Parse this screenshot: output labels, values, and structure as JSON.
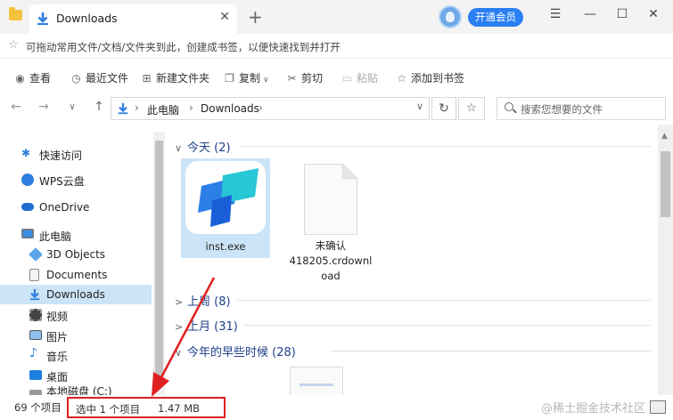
{
  "titlebar": {
    "tab_label": "Downloads",
    "tab_close": "✕",
    "new_tab": "+",
    "vip_button": "开通会员",
    "menu": "☰",
    "minimize": "—",
    "maximize": "☐",
    "close": "✕"
  },
  "bookmark_hint": "可拖动常用文件/文档/文件夹到此，创建成书签，以便快速找到并打开",
  "toolbar": {
    "view": "查看",
    "recent": "最近文件",
    "new_folder": "新建文件夹",
    "copy": "复制",
    "cut": "剪切",
    "paste": "粘贴",
    "add_bookmark": "添加到书签"
  },
  "address": {
    "crumbs": [
      "此电脑",
      "Downloads"
    ],
    "search_placeholder": "搜索您想要的文件"
  },
  "sidebar": {
    "items": [
      {
        "label": "快速访问",
        "icon": "pin-icon"
      },
      {
        "label": "WPS云盘",
        "icon": "cloud-icon"
      },
      {
        "label": "OneDrive",
        "icon": "onedrive-icon"
      },
      {
        "label": "此电脑",
        "icon": "computer-icon"
      },
      {
        "label": "3D Objects",
        "icon": "cube-icon"
      },
      {
        "label": "Documents",
        "icon": "document-icon"
      },
      {
        "label": "Downloads",
        "icon": "download-icon"
      },
      {
        "label": "视频",
        "icon": "video-icon"
      },
      {
        "label": "图片",
        "icon": "picture-icon"
      },
      {
        "label": "音乐",
        "icon": "music-icon"
      },
      {
        "label": "桌面",
        "icon": "desktop-icon"
      },
      {
        "label": "本地磁盘 (C:)",
        "icon": "disk-icon"
      }
    ]
  },
  "content": {
    "groups": [
      {
        "label": "今天 (2)",
        "chev": "∨"
      },
      {
        "label": "上周 (8)",
        "chev": ">"
      },
      {
        "label": "上月 (31)",
        "chev": ">"
      },
      {
        "label": "今年的早些时候 (28)",
        "chev": "∨"
      }
    ],
    "files": [
      {
        "name": "inst.exe"
      },
      {
        "name_lines": [
          "未确认",
          "418205.crdownl",
          "oad"
        ]
      }
    ]
  },
  "status": {
    "count": "69 个项目",
    "selected": "选中 1 个项目",
    "size": "1.47 MB",
    "watermark": "@稀土掘金技术社区"
  },
  "colors": {
    "accent": "#2b7ff3",
    "selection": "#cce4f7",
    "annotation": "#e02020",
    "group_text": "#1f3f88"
  }
}
